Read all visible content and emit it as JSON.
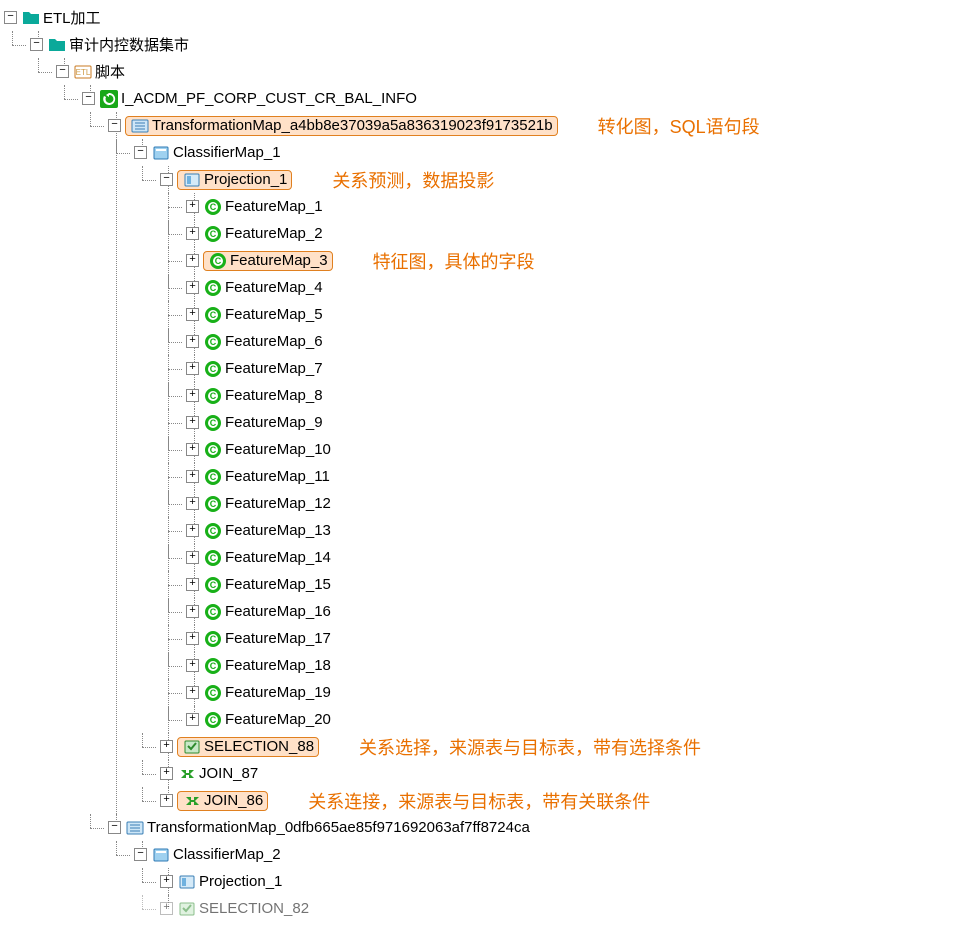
{
  "tree": {
    "root": {
      "label": "ETL加工"
    },
    "level1": {
      "label": "审计内控数据集市"
    },
    "script": {
      "label": "脚本"
    },
    "job": {
      "label": "I_ACDM_PF_CORP_CUST_CR_BAL_INFO"
    },
    "tmap1": {
      "label": "TransformationMap_a4bb8e37039a5a836319023f9173521b"
    },
    "cmap1": {
      "label": "ClassifierMap_1"
    },
    "proj1": {
      "label": "Projection_1"
    },
    "features": [
      "FeatureMap_1",
      "FeatureMap_2",
      "FeatureMap_3",
      "FeatureMap_4",
      "FeatureMap_5",
      "FeatureMap_6",
      "FeatureMap_7",
      "FeatureMap_8",
      "FeatureMap_9",
      "FeatureMap_10",
      "FeatureMap_11",
      "FeatureMap_12",
      "FeatureMap_13",
      "FeatureMap_14",
      "FeatureMap_15",
      "FeatureMap_16",
      "FeatureMap_17",
      "FeatureMap_18",
      "FeatureMap_19",
      "FeatureMap_20"
    ],
    "sel88": {
      "label": "SELECTION_88"
    },
    "join87": {
      "label": "JOIN_87"
    },
    "join86": {
      "label": "JOIN_86"
    },
    "tmap2": {
      "label": "TransformationMap_0dfb665ae85f971692063af7ff8724ca"
    },
    "cmap2": {
      "label": "ClassifierMap_2"
    },
    "proj2": {
      "label": "Projection_1"
    },
    "sel82": {
      "label": "SELECTION_82"
    }
  },
  "annotations": {
    "tmap": "转化图，SQL语句段",
    "proj": "关系预测，数据投影",
    "feat3": "特征图，具体的字段",
    "sel": "关系选择，来源表与目标表，带有选择条件",
    "join": "关系连接，来源表与目标表，带有关联条件"
  },
  "toggle": {
    "expanded": "−",
    "collapsed": "+"
  }
}
